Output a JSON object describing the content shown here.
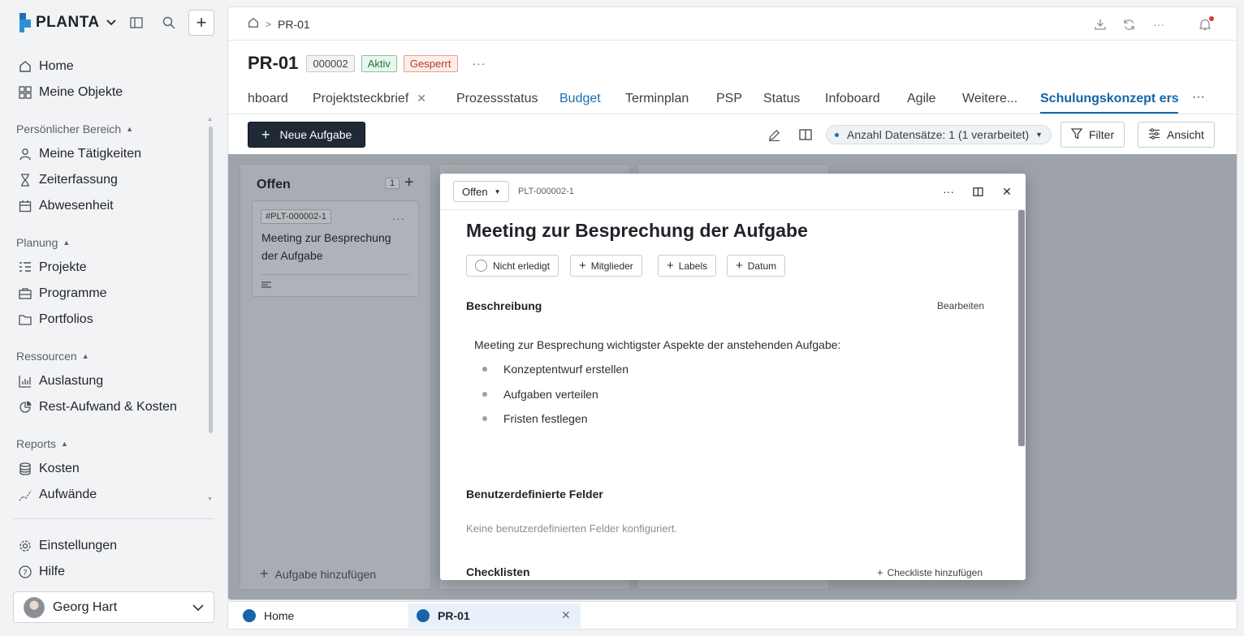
{
  "brand": {
    "name": "PLANTA"
  },
  "sidebar": {
    "top_items": [
      {
        "label": "Home",
        "icon": "home-icon"
      },
      {
        "label": "Meine Objekte",
        "icon": "grid-icon"
      }
    ],
    "sections": [
      {
        "title": "Persönlicher Bereich",
        "items": [
          "Meine Tätigkeiten",
          "Zeiterfassung",
          "Abwesenheit"
        ]
      },
      {
        "title": "Planung",
        "items": [
          "Projekte",
          "Programme",
          "Portfolios"
        ]
      },
      {
        "title": "Ressourcen",
        "items": [
          "Auslastung",
          "Rest-Aufwand & Kosten"
        ]
      },
      {
        "title": "Reports",
        "items": [
          "Kosten",
          "Aufwände"
        ]
      }
    ],
    "bottom_items": [
      {
        "label": "Einstellungen",
        "icon": "gear-icon"
      },
      {
        "label": "Hilfe",
        "icon": "help-icon"
      }
    ],
    "user": {
      "name": "Georg Hart"
    }
  },
  "topbar": {
    "breadcrumb": [
      "PR-01"
    ]
  },
  "project": {
    "title": "PR-01",
    "number": "000002",
    "status_active": "Aktiv",
    "status_locked": "Gesperrt"
  },
  "tabs": [
    {
      "label": "hboard"
    },
    {
      "label": "Projektsteckbrief"
    },
    {
      "label": "Prozessstatus"
    },
    {
      "label": "Budget"
    },
    {
      "label": "Terminplan"
    },
    {
      "label": "PSP"
    },
    {
      "label": "Status"
    },
    {
      "label": "Infoboard"
    },
    {
      "label": "Agile"
    },
    {
      "label": "Weitere..."
    },
    {
      "label": "Schulungskonzept erstel"
    }
  ],
  "toolbar": {
    "new_task": "Neue Aufgabe",
    "record_count": "Anzahl Datensätze: 1 (1 verarbeitet)",
    "filter": "Filter",
    "view": "Ansicht"
  },
  "board": {
    "column": {
      "title": "Offen",
      "count": "1",
      "add_task": "Aufgabe hinzufügen"
    },
    "card": {
      "id": "#PLT-000002-1",
      "title": "Meeting zur Besprechung der Aufgabe"
    }
  },
  "modal": {
    "status": "Offen",
    "id": "PLT-000002-1",
    "title": "Meeting zur Besprechung der Aufgabe",
    "chips": {
      "done": "Nicht erledigt",
      "members": "Mitglieder",
      "labels": "Labels",
      "date": "Datum"
    },
    "description_title": "Beschreibung",
    "edit": "Bearbeiten",
    "description_intro": "Meeting zur Besprechung wichtigster Aspekte der anstehenden Aufgabe:",
    "bullets": [
      "Konzeptentwurf erstellen",
      "Aufgaben verteilen",
      "Fristen festlegen"
    ],
    "custom_fields_title": "Benutzerdefinierte Felder",
    "custom_fields_empty": "Keine benutzerdefinierten Felder konfiguriert.",
    "checklists_title": "Checklisten",
    "add_checklist": "Checkliste hinzufügen"
  },
  "taskbar": [
    {
      "label": "Home"
    },
    {
      "label": "PR-01"
    }
  ],
  "colors": {
    "accent": "#1565a8",
    "primary_button": "#1f2a36",
    "notification": "#e0352b"
  }
}
